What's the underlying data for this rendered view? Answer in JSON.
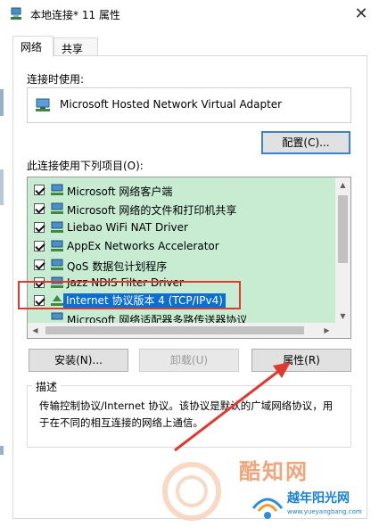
{
  "window": {
    "title": "本地连接* 11 属性",
    "close_glyph": "✕"
  },
  "tabs": [
    {
      "label": "网络"
    },
    {
      "label": "共享"
    }
  ],
  "connect_using_label": "连接时使用:",
  "adapter_name": "Microsoft Hosted Network Virtual Adapter",
  "configure_button": "配置(C)...",
  "items_label": "此连接使用下列项目(O):",
  "items": [
    {
      "label": "Microsoft 网络客户端",
      "checked": true
    },
    {
      "label": "Microsoft 网络的文件和打印机共享",
      "checked": true
    },
    {
      "label": "Liebao WiFi NAT Driver",
      "checked": true
    },
    {
      "label": "AppEx Networks Accelerator",
      "checked": true
    },
    {
      "label": "QoS 数据包计划程序",
      "checked": true
    },
    {
      "label": "Jazz NDIS Filter Driver",
      "checked": true
    },
    {
      "label": "Internet 协议版本 4 (TCP/IPv4)",
      "checked": true,
      "selected": true
    },
    {
      "label": "Microsoft 网络适配器多路传送器协议",
      "checked": false
    }
  ],
  "buttons": {
    "install": "安装(N)...",
    "uninstall": "卸载(U)",
    "properties": "属性(R)"
  },
  "description": {
    "title": "描述",
    "text": "传输控制协议/Internet 协议。该协议是默认的广域网络协议，用于在不同的相互连接的网络上通信。"
  },
  "watermark": {
    "brand": "酷知网",
    "site_name": "越年阳光网",
    "url": "www.yueyangbang.com"
  },
  "colors": {
    "list_bg": "#c7ecd2",
    "selection": "#0b6fd1",
    "highlight_box": "#e03a30",
    "arrow": "#e03a30"
  }
}
